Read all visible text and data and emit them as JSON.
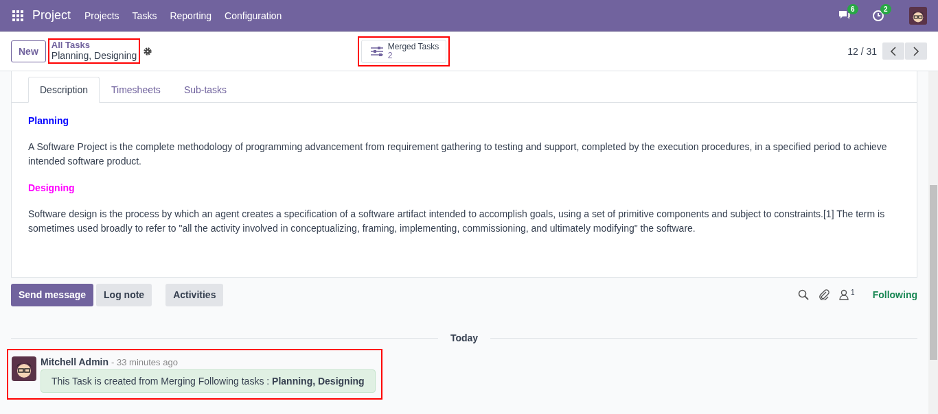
{
  "navbar": {
    "app": "Project",
    "menus": [
      "Projects",
      "Tasks",
      "Reporting",
      "Configuration"
    ],
    "messages_badge": "6",
    "activities_badge": "2"
  },
  "control_panel": {
    "new_button": "New",
    "breadcrumb": {
      "parent": "All Tasks",
      "current": "Planning, Designing",
      "highlighted": true
    },
    "merged_button": {
      "label": "Merged Tasks",
      "count": "2",
      "highlighted": true
    },
    "pager": "12 / 31"
  },
  "tabs": [
    {
      "label": "Description",
      "selected": true
    },
    {
      "label": "Timesheets",
      "selected": false
    },
    {
      "label": "Sub-tasks",
      "selected": false
    }
  ],
  "description": [
    {
      "heading": "Planning",
      "color": "#0000ff",
      "text": "A Software Project is the complete methodology of programming advancement from requirement gathering to testing and support, completed by the execution procedures, in a specified period to achieve intended software product."
    },
    {
      "heading": "Designing",
      "color": "#ff00ff",
      "text": "Software design is the process by which an agent creates a specification of a software artifact intended to accomplish goals, using a set of primitive components and subject to constraints.[1] The term is sometimes used broadly to refer to \"all the activity involved in conceptualizing, framing, implementing, commissioning, and ultimately modifying\" the software."
    }
  ],
  "chatter": {
    "buttons": [
      {
        "label": "Send message",
        "selected": true
      },
      {
        "label": "Log note",
        "selected": false
      },
      {
        "label": "Activities",
        "selected": false
      }
    ],
    "followers_count": "1",
    "following": "Following",
    "date_separator": "Today",
    "messages": [
      {
        "author": "Mitchell Admin",
        "time": "- 33 minutes ago",
        "body": "This Task is created from Merging Following tasks : **Planning,  Designing**",
        "highlighted": true
      }
    ]
  }
}
